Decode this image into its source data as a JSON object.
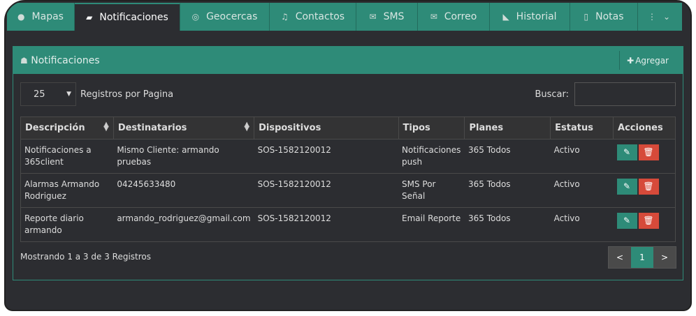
{
  "tabs": [
    {
      "label": "Mapas",
      "icon": "globe-icon"
    },
    {
      "label": "Notificaciones",
      "icon": "comment-icon",
      "active": true
    },
    {
      "label": "Geocercas",
      "icon": "compass-icon"
    },
    {
      "label": "Contactos",
      "icon": "bell-icon"
    },
    {
      "label": "SMS",
      "icon": "envelope-outline-icon"
    },
    {
      "label": "Correo",
      "icon": "envelope-icon"
    },
    {
      "label": "Historial",
      "icon": "rss-icon"
    },
    {
      "label": "Notas",
      "icon": "file-icon"
    }
  ],
  "panel": {
    "title": "Notificaciones",
    "add_label": "Agregar"
  },
  "controls": {
    "page_size": "25",
    "page_size_label": "Registros por Pagina",
    "search_label": "Buscar:",
    "search_value": ""
  },
  "table": {
    "headers": [
      "Descripción",
      "Destinatarios",
      "Dispositivos",
      "Tipos",
      "Planes",
      "Estatus",
      "Acciones"
    ],
    "rows": [
      [
        "Notificaciones a 365client",
        "Mismo Cliente: armando pruebas",
        "SOS-1582120012",
        "Notificaciones push",
        "365 Todos",
        "Activo"
      ],
      [
        "Alarmas Armando Rodriguez",
        "04245633480",
        "SOS-1582120012",
        "SMS Por Señal",
        "365 Todos",
        "Activo"
      ],
      [
        "Reporte diario armando",
        "armando_rodriguez@gmail.com",
        "SOS-1582120012",
        "Email Reporte",
        "365 Todos",
        "Activo"
      ]
    ]
  },
  "footer": {
    "info": "Mostrando 1 a 3 de 3 Registros",
    "prev": "<",
    "page": "1",
    "next": ">"
  },
  "colors": {
    "accent": "#2e8b78",
    "danger": "#d64a3a",
    "background": "#2c2d31"
  }
}
